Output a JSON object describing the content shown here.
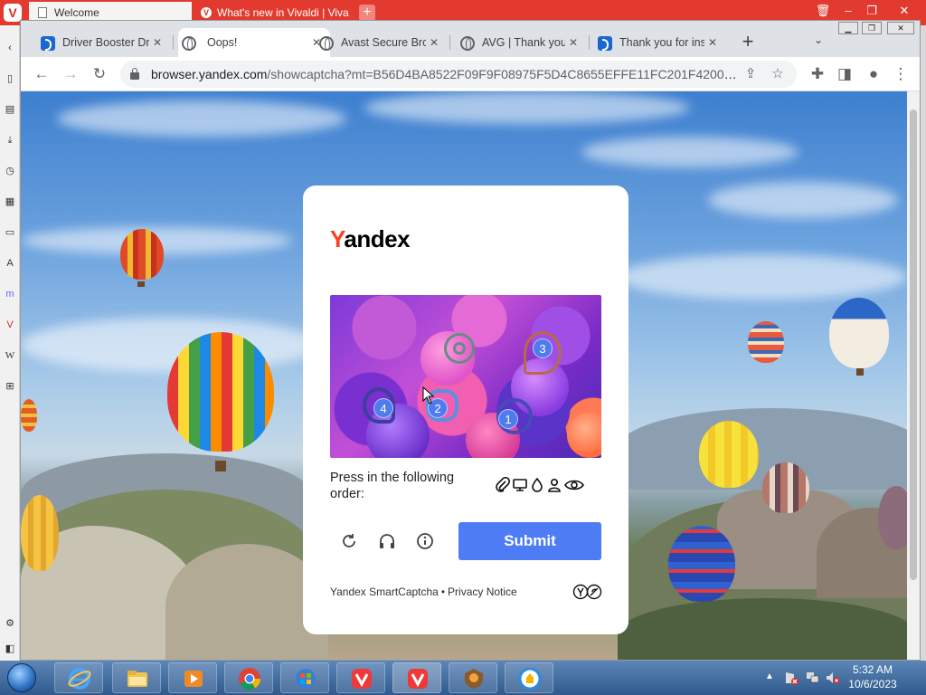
{
  "vivaldi": {
    "tabs": [
      {
        "label": "Welcome"
      },
      {
        "label": "What's new in Vivaldi | Viva"
      }
    ]
  },
  "chrome": {
    "tabs": [
      {
        "label": "Driver Booster Dr"
      },
      {
        "label": "Oops!"
      },
      {
        "label": "Avast Secure Bro"
      },
      {
        "label": "AVG | Thank you"
      },
      {
        "label": "Thank you for ins"
      }
    ],
    "active_tab": 1,
    "address": {
      "host": "browser.yandex.com",
      "path": "/showcaptcha?mt=B56D4BA8522F09F9F08975F5D4C8655EFFE11FC201F420067F1..."
    }
  },
  "captcha": {
    "brand_first_letter": "Y",
    "brand_rest": "andex",
    "markers": [
      "1",
      "2",
      "3",
      "4"
    ],
    "instruction": "Press in the following order:",
    "order_icons": [
      "paperclip-icon",
      "monitor-icon",
      "drop-icon",
      "person-icon",
      "eye-icon"
    ],
    "submit_label": "Submit",
    "footer_product": "Yandex SmartCaptcha",
    "footer_separator": "•",
    "footer_privacy": "Privacy Notice"
  },
  "taskbar": {
    "apps": [
      "ie-icon",
      "explorer-icon",
      "media-player-icon",
      "chrome-icon",
      "windows-update-icon",
      "vivaldi-icon",
      "vivaldi-icon",
      "avast-icon",
      "avg-browser-icon"
    ],
    "clock_time": "5:32 AM",
    "clock_date": "10/6/2023"
  },
  "colors": {
    "vivaldi_red": "#e23a2e",
    "yandex_red": "#fc3f1d",
    "submit_blue": "#4e7cf5",
    "marker_blue": "#4e7cf0"
  }
}
